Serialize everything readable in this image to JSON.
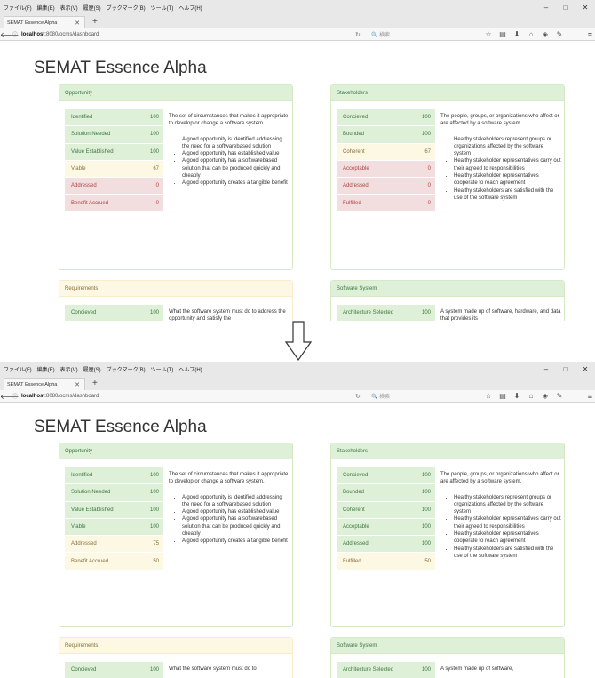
{
  "browser": {
    "menu": [
      "ファイル(F)",
      "編集(E)",
      "表示(V)",
      "履歴(S)",
      "ブックマーク(B)",
      "ツール(T)",
      "ヘルプ(H)"
    ],
    "tab_title": "SEMAT Essence Alpha",
    "url_host": "localhost",
    "url_path": ":8080/ocms/dashboard",
    "search_placeholder": "検索",
    "win_minimize": "–",
    "win_maximize": "□",
    "win_close": "✕",
    "new_tab": "+",
    "tab_close": "✕"
  },
  "page_title": "SEMAT Essence Alpha",
  "screens": [
    {
      "panels": [
        {
          "title": "Opportunity",
          "states": [
            {
              "name": "Identified",
              "value": "100",
              "status": "green"
            },
            {
              "name": "Solution Needed",
              "value": "100",
              "status": "green"
            },
            {
              "name": "Value Established",
              "value": "100",
              "status": "green"
            },
            {
              "name": "Viable",
              "value": "67",
              "status": "yellow"
            },
            {
              "name": "Addressed",
              "value": "0",
              "status": "red"
            },
            {
              "name": "Benefit Accrued",
              "value": "0",
              "status": "red"
            }
          ],
          "description": "The set of circumstances that makes it appropriate to develop or change a software system.",
          "bullets": [
            "A good opportunity is identified addressing the need for a softwarebased solution",
            "A good opportunity has established value",
            "A good opportunity has a softwarebased solution that can be produced quickly and cheaply",
            "A good opportunity creates a tangible benefit"
          ]
        },
        {
          "title": "Stakeholders",
          "states": [
            {
              "name": "Concieved",
              "value": "100",
              "status": "green"
            },
            {
              "name": "Bounded",
              "value": "100",
              "status": "green"
            },
            {
              "name": "Coherent",
              "value": "67",
              "status": "yellow"
            },
            {
              "name": "Acceptable",
              "value": "0",
              "status": "red"
            },
            {
              "name": "Addressed",
              "value": "0",
              "status": "red"
            },
            {
              "name": "Fulfilled",
              "value": "0",
              "status": "red"
            }
          ],
          "description": "The people, groups, or organizations who affect or are affected by a software system.",
          "bullets": [
            "Healthy stakeholders represent groups or organizations affected by the software system",
            "Healthy stakeholder representatives carry out their agreed to responsibilities",
            "Healthy stakeholder representatives cooperate to reach agreement",
            "Healthy stakeholders are satisfied with the use of the software system"
          ]
        },
        {
          "title": "Requirements",
          "states": [
            {
              "name": "Concieved",
              "value": "100",
              "status": "green"
            }
          ],
          "description": "What the software system must do to address the opportunity and satisfy the",
          "bullets": []
        },
        {
          "title": "Software System",
          "states": [
            {
              "name": "Architecture Selected",
              "value": "100",
              "status": "green"
            }
          ],
          "description": "A system made up of software, hardware, and data that provides its",
          "bullets": []
        }
      ]
    },
    {
      "panels": [
        {
          "title": "Opportunity",
          "states": [
            {
              "name": "Identified",
              "value": "100",
              "status": "green"
            },
            {
              "name": "Solution Needed",
              "value": "100",
              "status": "green"
            },
            {
              "name": "Value Established",
              "value": "100",
              "status": "green"
            },
            {
              "name": "Viable",
              "value": "100",
              "status": "green"
            },
            {
              "name": "Addressed",
              "value": "75",
              "status": "yellow"
            },
            {
              "name": "Benefit Accrued",
              "value": "50",
              "status": "yellow"
            }
          ],
          "description": "The set of circumstances that makes it appropriate to develop or change a software system.",
          "bullets": [
            "A good opportunity is identified addressing the need for a softwarebased solution",
            "A good opportunity has established value",
            "A good opportunity has a softwarebased solution that can be produced quickly and cheaply",
            "A good opportunity creates a tangible benefit"
          ]
        },
        {
          "title": "Stakeholders",
          "states": [
            {
              "name": "Concieved",
              "value": "100",
              "status": "green"
            },
            {
              "name": "Bounded",
              "value": "100",
              "status": "green"
            },
            {
              "name": "Coherent",
              "value": "100",
              "status": "green"
            },
            {
              "name": "Acceptable",
              "value": "100",
              "status": "green"
            },
            {
              "name": "Addressed",
              "value": "100",
              "status": "green"
            },
            {
              "name": "Fulfilled",
              "value": "50",
              "status": "yellow"
            }
          ],
          "description": "The people, groups, or organizations who affect or are affected by a software system.",
          "bullets": [
            "Healthy stakeholders represent groups or organizations affected by the software system",
            "Healthy stakeholder representatives carry out their agreed to responsibilities",
            "Healthy stakeholder representatives cooperate to reach agreement",
            "Healthy stakeholders are satisfied with the use of the software system"
          ]
        },
        {
          "title": "Requirements",
          "states": [
            {
              "name": "Concieved",
              "value": "100",
              "status": "green"
            }
          ],
          "description": "What the software system must do to",
          "bullets": []
        },
        {
          "title": "Software System",
          "states": [
            {
              "name": "Architecture Selected",
              "value": "100",
              "status": "green"
            }
          ],
          "description": "A system made up of software,",
          "bullets": []
        }
      ]
    }
  ],
  "colors": {
    "green_bg": "#dff0d8",
    "green_text": "#3c763d",
    "yellow_bg": "#fcf8e3",
    "yellow_text": "#8a6d3b",
    "red_bg": "#f2dede",
    "red_text": "#a94442"
  }
}
